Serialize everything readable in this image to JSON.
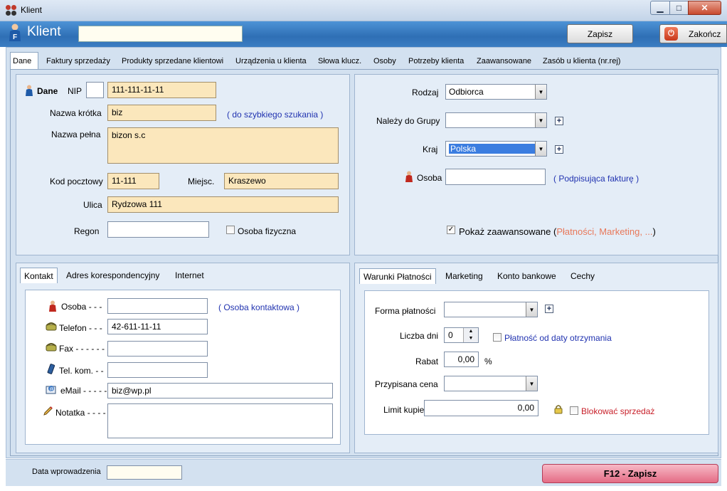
{
  "window": {
    "title": "Klient"
  },
  "header": {
    "title": "Klient",
    "search_value": "",
    "save_label": "Zapisz",
    "end_label": "Zakończ"
  },
  "tabs": [
    {
      "label": "Dane"
    },
    {
      "label": "Faktury sprzedaży"
    },
    {
      "label": "Produkty sprzedane klientowi"
    },
    {
      "label": "Urządzenia u klienta"
    },
    {
      "label": "Słowa klucz."
    },
    {
      "label": "Osoby"
    },
    {
      "label": "Potrzeby klienta"
    },
    {
      "label": "Zaawansowane"
    },
    {
      "label": "Zasób u klienta (nr.rej)"
    }
  ],
  "dane": {
    "section_label": "Dane",
    "nip_label": "NIP",
    "nip_prefix": "",
    "nip_value": "111-111-11-11",
    "short_name_label": "Nazwa krótka",
    "short_name_value": "biz",
    "short_name_hint": "( do szybkiego szukania )",
    "full_name_label": "Nazwa pełna",
    "full_name_value": "bizon s.c",
    "postal_label": "Kod pocztowy",
    "postal_value": "11-111",
    "city_label": "Miejsc.",
    "city_value": "Kraszewo",
    "street_label": "Ulica",
    "street_value": "Rydzowa 111",
    "regon_label": "Regon",
    "regon_value": "",
    "person_label": "Osoba fizyczna"
  },
  "right": {
    "type_label": "Rodzaj",
    "type_value": "Odbiorca",
    "group_label": "Należy do Grupy",
    "group_value": "",
    "country_label": "Kraj",
    "country_value": "Polska",
    "person_label": "Osoba",
    "person_value": "",
    "person_hint": "( Podpisująca fakturę )",
    "advanced_label": "Pokaż zaawansowane",
    "advanced_open": "(",
    "advanced_detail": "Płatności, Marketing, ...",
    "advanced_close": ")",
    "advanced_checked": "✓"
  },
  "contact_tabs": [
    {
      "label": "Kontakt"
    },
    {
      "label": "Adres korespondencyjny"
    },
    {
      "label": "Internet"
    }
  ],
  "contact": {
    "person_label": "Osoba - - -",
    "person_value": "",
    "person_hint": "( Osoba kontaktowa )",
    "phone_label": "Telefon - - -",
    "phone_value": "42-611-11-11",
    "fax_label": "Fax - - - - - -",
    "fax_value": "",
    "mobile_label": "Tel. kom. - -",
    "mobile_value": "",
    "email_label": "eMail - - - - -",
    "email_value": "biz@wp.pl",
    "note_label": "Notatka - - - -",
    "note_value": ""
  },
  "payment_tabs": [
    {
      "label": "Warunki Płatności"
    },
    {
      "label": "Marketing"
    },
    {
      "label": "Konto bankowe"
    },
    {
      "label": "Cechy"
    }
  ],
  "payment": {
    "form_label": "Forma płatności",
    "form_value": "",
    "days_label": "Liczba dni",
    "days_value": "0",
    "from_receipt_label": "Płatność od daty otrzymania",
    "discount_label": "Rabat",
    "discount_value": "0,00",
    "discount_unit": "%",
    "price_label": "Przypisana cena",
    "price_value": "",
    "limit_label": "Limit kupiecki",
    "limit_value": "0,00",
    "block_label": "Blokować sprzedaż"
  },
  "footer": {
    "date_label": "Data wprowadzenia",
    "date_value": "",
    "save_label": "F12 - Zapisz"
  },
  "colors": {
    "accent": "#2f6fb5",
    "field": "#fbe7bc",
    "hint": "#2133b0",
    "advanced": "#e8785a",
    "block": "#c8202a"
  }
}
